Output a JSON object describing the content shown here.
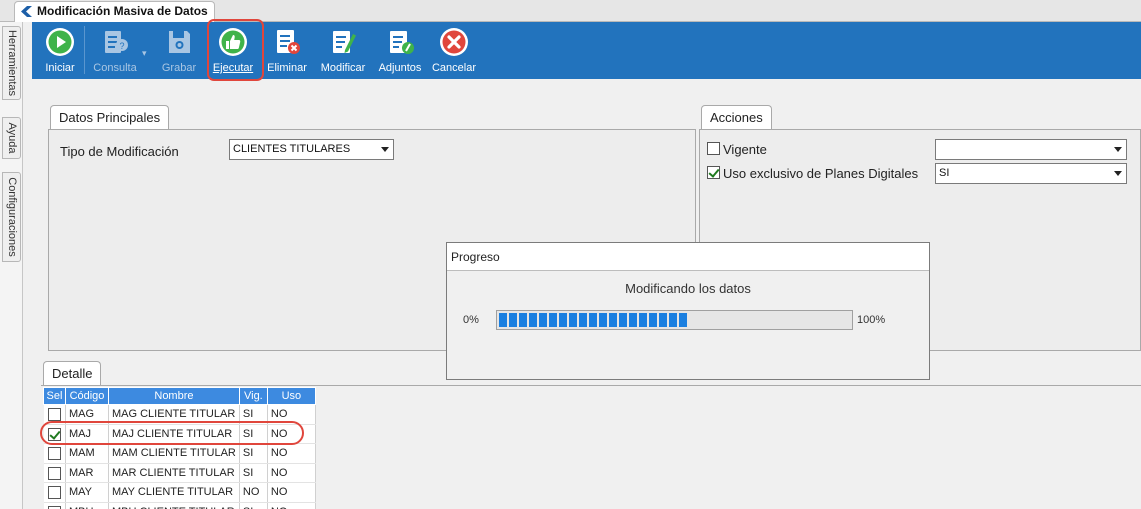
{
  "window": {
    "title": "Modificación Masiva de Datos"
  },
  "side_tabs": [
    "Herramientas",
    "Ayuda",
    "Configuraciones"
  ],
  "toolbar": {
    "buttons": [
      {
        "label": "Iniciar",
        "icon": "play-icon",
        "enabled": true
      },
      {
        "label": "Consulta",
        "icon": "query-document-icon",
        "enabled": false
      },
      {
        "label": "Grabar",
        "icon": "save-disk-icon",
        "enabled": false
      },
      {
        "label": "Ejecutar",
        "icon": "thumbs-up-icon",
        "enabled": true
      },
      {
        "label": "Eliminar",
        "icon": "delete-document-icon",
        "enabled": true
      },
      {
        "label": "Modificar",
        "icon": "edit-document-icon",
        "enabled": true
      },
      {
        "label": "Adjuntos",
        "icon": "attachment-document-icon",
        "enabled": true
      },
      {
        "label": "Cancelar",
        "icon": "cancel-icon",
        "enabled": true
      }
    ]
  },
  "datos_principales": {
    "tab_label": "Datos Principales",
    "tipo_label": "Tipo de Modificación",
    "tipo_value": "CLIENTES TITULARES"
  },
  "acciones": {
    "tab_label": "Acciones",
    "vigente_label": "Vigente",
    "vigente_checked": false,
    "vigente_value": "",
    "uso_label": "Uso exclusivo de Planes Digitales",
    "uso_checked": true,
    "uso_value": "SI"
  },
  "progress": {
    "title": "Progreso",
    "message": "Modificando los datos",
    "min_label": "0%",
    "max_label": "100%",
    "value": 0.56
  },
  "detalle": {
    "tab_label": "Detalle",
    "columns": [
      "Sel",
      "Código",
      "Nombre",
      "Vig.",
      "Uso"
    ],
    "rows": [
      {
        "sel": false,
        "codigo": "MAG",
        "nombre": "MAG CLIENTE TITULAR",
        "vig": "SI",
        "uso": "NO"
      },
      {
        "sel": true,
        "codigo": "MAJ",
        "nombre": "MAJ CLIENTE TITULAR",
        "vig": "SI",
        "uso": "NO"
      },
      {
        "sel": false,
        "codigo": "MAM",
        "nombre": "MAM CLIENTE TITULAR",
        "vig": "SI",
        "uso": "NO"
      },
      {
        "sel": false,
        "codigo": "MAR",
        "nombre": "MAR CLIENTE TITULAR",
        "vig": "SI",
        "uso": "NO"
      },
      {
        "sel": false,
        "codigo": "MAY",
        "nombre": "MAY CLIENTE TITULAR",
        "vig": "NO",
        "uso": "NO"
      },
      {
        "sel": false,
        "codigo": "MBU",
        "nombre": "MBU CLIENTE TITULAR",
        "vig": "SI",
        "uso": "NO"
      }
    ]
  },
  "colors": {
    "toolbar_bg": "#2273bd",
    "grid_header": "#3d8ae0",
    "highlight": "#e0463c",
    "progress": "#1a7fe0"
  }
}
